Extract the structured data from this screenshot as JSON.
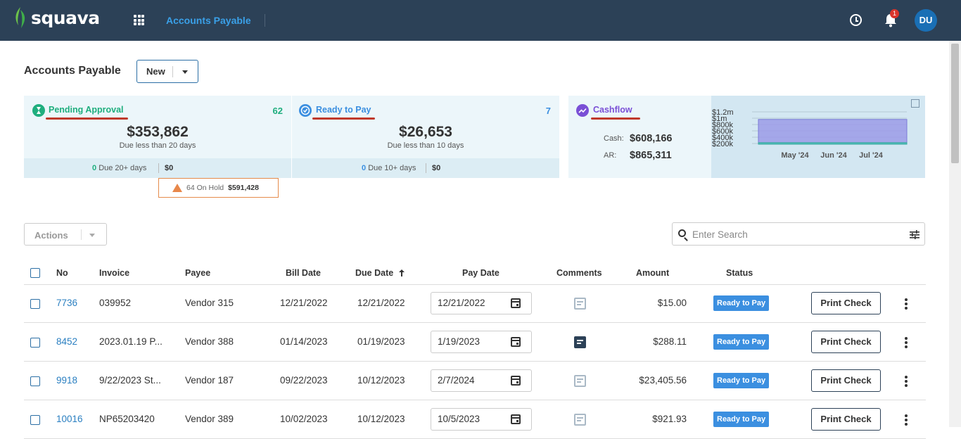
{
  "header": {
    "logo_text": "squava",
    "module_title": "Accounts Payable",
    "notification_count": "1",
    "avatar_initials": "DU"
  },
  "page": {
    "title": "Accounts Payable",
    "new_button": "New"
  },
  "cards": {
    "pending": {
      "title": "Pending Approval",
      "count": "62",
      "amount": "$353,862",
      "due_text": "Due less than 20 days",
      "foot_count": "0",
      "foot_label": "Due 20+ days",
      "foot_amount": "$0",
      "color": "#1fae7e"
    },
    "ready": {
      "title": "Ready to Pay",
      "count": "7",
      "amount": "$26,653",
      "due_text": "Due less than 10 days",
      "foot_count": "0",
      "foot_label": "Due 10+ days",
      "foot_amount": "$0",
      "color": "#3b8fe0"
    },
    "cashflow": {
      "title": "Cashflow",
      "cash_label": "Cash:",
      "cash_value": "$608,166",
      "ar_label": "AR:",
      "ar_value": "$865,311",
      "color": "#7a4fd6"
    },
    "on_hold": {
      "label": "64 On Hold",
      "amount": "$591,428"
    }
  },
  "chart_data": {
    "type": "area",
    "y_ticks": [
      "$1.2m",
      "$1m",
      "$800k",
      "$600k",
      "$400k",
      "$200k"
    ],
    "x_ticks": [
      "May '24",
      "Jun '24",
      "Jul '24"
    ],
    "ylim": [
      200000,
      1200000
    ],
    "series": [
      {
        "values": [
          1000000,
          1000000,
          1000000,
          1000000
        ],
        "color": "#9b9be8"
      },
      {
        "values": [
          250000,
          250000,
          250000,
          250000
        ],
        "color": "#4fbfb8"
      }
    ]
  },
  "toolbar": {
    "actions_label": "Actions",
    "search_placeholder": "Enter Search"
  },
  "table": {
    "columns": [
      "No",
      "Invoice",
      "Payee",
      "Bill Date",
      "Due Date",
      "Pay Date",
      "Comments",
      "Amount",
      "Status"
    ],
    "rows": [
      {
        "no": "7736",
        "invoice": "039952",
        "payee": "Vendor 315",
        "bill_date": "12/21/2022",
        "due_date": "12/21/2022",
        "pay_date": "12/21/2022",
        "comment_filled": false,
        "amount": "$15.00",
        "status": "Ready to Pay",
        "action": "Print Check"
      },
      {
        "no": "8452",
        "invoice": "2023.01.19 P...",
        "payee": "Vendor 388",
        "bill_date": "01/14/2023",
        "due_date": "01/19/2023",
        "pay_date": "1/19/2023",
        "comment_filled": true,
        "amount": "$288.11",
        "status": "Ready to Pay",
        "action": "Print Check"
      },
      {
        "no": "9918",
        "invoice": "9/22/2023 St...",
        "payee": "Vendor 187",
        "bill_date": "09/22/2023",
        "due_date": "10/12/2023",
        "pay_date": "2/7/2024",
        "comment_filled": false,
        "amount": "$23,405.56",
        "status": "Ready to Pay",
        "action": "Print Check"
      },
      {
        "no": "10016",
        "invoice": "NP65203420",
        "payee": "Vendor 389",
        "bill_date": "10/02/2023",
        "due_date": "10/12/2023",
        "pay_date": "10/5/2023",
        "comment_filled": false,
        "amount": "$921.93",
        "status": "Ready to Pay",
        "action": "Print Check"
      }
    ]
  }
}
